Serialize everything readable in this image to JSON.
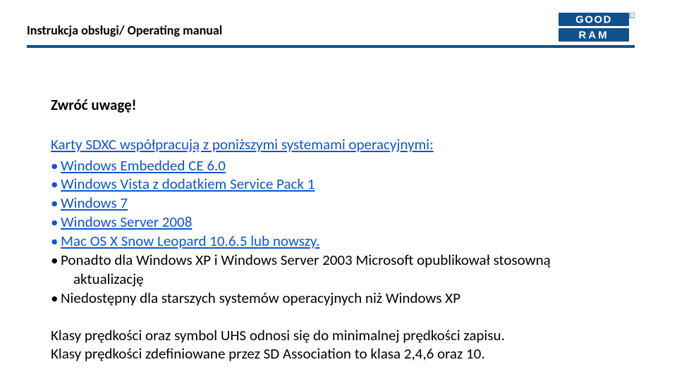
{
  "header": {
    "title": "Instrukcja obsługi/ Operating manual",
    "logo": {
      "line1": "GOOD",
      "line2": "RAM",
      "reg": "®"
    }
  },
  "content": {
    "attention": "Zwróć uwagę!",
    "intro": "Karty SDXC współpracują z poniższymi systemami operacyjnymi:",
    "blue_items": [
      "Windows Embedded CE 6.0",
      "Windows Vista z dodatkiem Service Pack 1",
      "Windows 7",
      "Windows Server 2008",
      "Mac OS X Snow Leopard 10.6.5 lub nowszy."
    ],
    "black_items": [
      {
        "first": "Ponadto dla Windows XP i Windows Server 2003 Microsoft opublikował stosowną",
        "second": "aktualizację"
      },
      {
        "first": "Niedostępny dla starszych systemów operacyjnych niż Windows XP"
      }
    ],
    "para1": "Klasy prędkości oraz symbol UHS odnosi się do minimalnej prędkości zapisu.",
    "para2": "Klasy prędkości zdefiniowane przez SD Association to klasa 2,4,6 oraz 10."
  }
}
